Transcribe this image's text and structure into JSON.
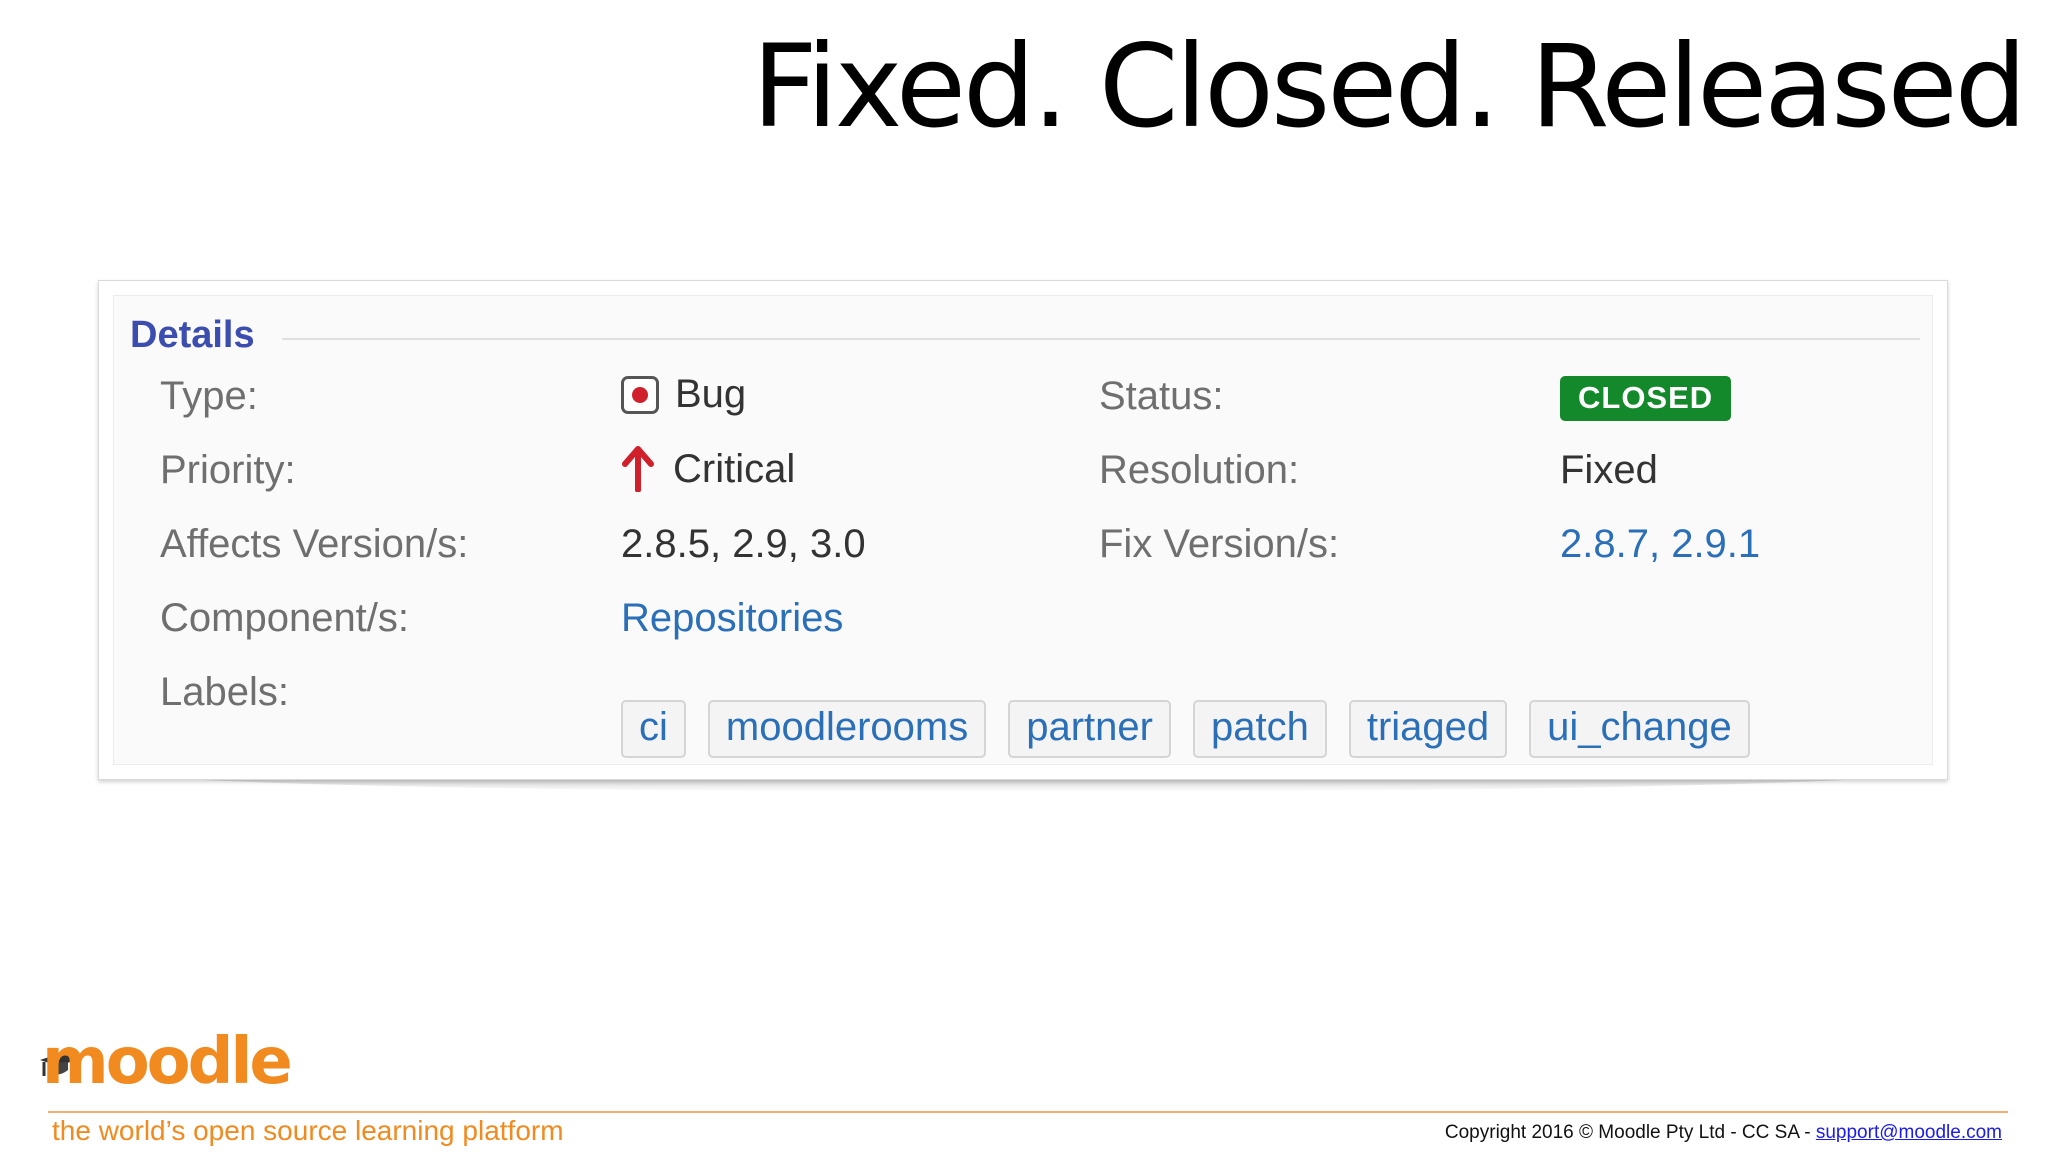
{
  "slide": {
    "title": "Fixed. Closed. Released"
  },
  "details": {
    "heading": "Details",
    "type_label": "Type:",
    "type_value": "Bug",
    "priority_label": "Priority:",
    "priority_value": "Critical",
    "affects_label": "Affects Version/s:",
    "affects_value": "2.8.5, 2.9, 3.0",
    "component_label": "Component/s:",
    "component_value": "Repositories",
    "labels_label": "Labels:",
    "labels": [
      "ci",
      "moodlerooms",
      "partner",
      "patch",
      "triaged",
      "ui_change"
    ],
    "status_label": "Status:",
    "status_value": "CLOSED",
    "resolution_label": "Resolution:",
    "resolution_value": "Fixed",
    "fix_label": "Fix Version/s:",
    "fix_value": "2.8.7, 2.9.1"
  },
  "icons": {
    "type": "bug-icon",
    "priority": "arrow-up-icon",
    "logo_cap": "graduation-cap-icon"
  },
  "colors": {
    "heading": "#3c4db0",
    "link": "#2a6fb8",
    "status_badge": "#14892c",
    "priority_arrow": "#d0202c",
    "brand_orange": "#f18a1f"
  },
  "footer": {
    "logo_text": "moodle",
    "tagline": "the world’s open source learning platform",
    "copyright": "Copyright 2016 © Moodle Pty Ltd  - CC SA - ",
    "email": "support@moodle.com"
  }
}
